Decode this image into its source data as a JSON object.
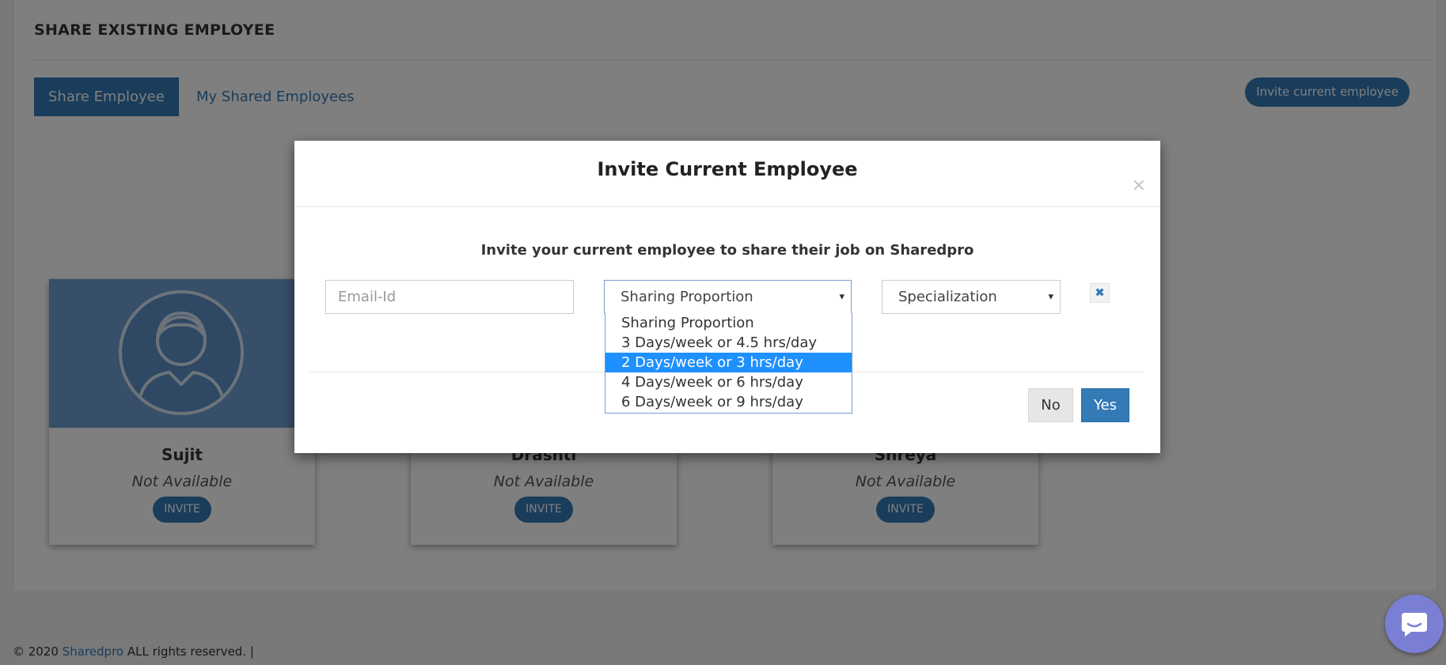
{
  "page": {
    "title": "SHARE EXISTING EMPLOYEE",
    "tabs": [
      {
        "label": "Share Employee"
      },
      {
        "label": "My Shared Employees"
      }
    ],
    "invite_current_button": "Invite current employee",
    "employees": [
      {
        "name": "Sujit",
        "status": "Not Available",
        "invite_label": "INVITE"
      },
      {
        "name": "Drashti",
        "status": "Not Available",
        "invite_label": "INVITE"
      },
      {
        "name": "Shreya",
        "status": "Not Available",
        "invite_label": "INVITE"
      }
    ]
  },
  "footer": {
    "prefix": "© 2020",
    "brand": "Sharedpro",
    "suffix": "ALL rights reserved.  |"
  },
  "modal": {
    "title": "Invite Current Employee",
    "close_symbol": "×",
    "description": "Invite your current employee to share their job on Sharedpro",
    "email_placeholder": "Email-Id",
    "sharing_select_value": "Sharing Proportion",
    "specialization_select_value": "Specialization",
    "remove_symbol": "✖",
    "no_label": "No",
    "yes_label": "Yes",
    "dropdown_options": [
      {
        "label": "Sharing Proportion",
        "selected": false
      },
      {
        "label": "3 Days/week or 4.5 hrs/day",
        "selected": false
      },
      {
        "label": "2 Days/week or 3 hrs/day",
        "selected": true
      },
      {
        "label": "4 Days/week or 6 hrs/day",
        "selected": false
      },
      {
        "label": "6 Days/week or 9 hrs/day",
        "selected": false
      }
    ]
  },
  "icons": {
    "caret": "▾",
    "chat": "chat-icon"
  },
  "colors": {
    "primary": "#337ab7",
    "highlight": "#1e90ff",
    "chat_widget": "#7b7fd4"
  }
}
